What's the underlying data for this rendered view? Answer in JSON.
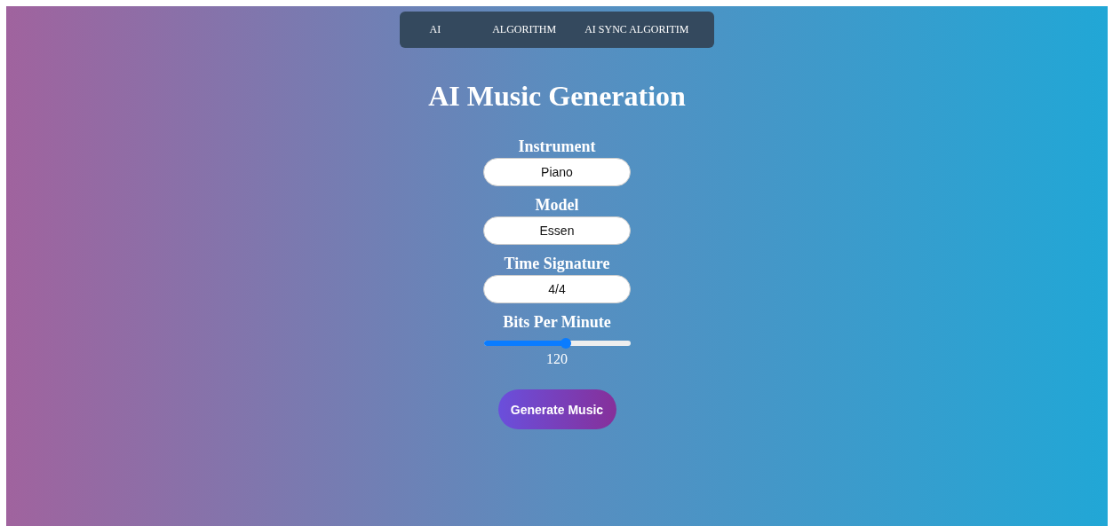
{
  "nav": [
    {
      "label": "AI"
    },
    {
      "label": "ALGORITHM"
    },
    {
      "label": "AI SYNC ALGORITIM"
    }
  ],
  "title": "AI Music Generation",
  "fields": [
    {
      "kind": "text",
      "label": "Instrument",
      "value": "Piano"
    },
    {
      "kind": "text",
      "label": "Model",
      "value": "Essen"
    },
    {
      "kind": "text",
      "label": "Time Signature",
      "value": "4/4"
    },
    {
      "kind": "slider",
      "label": "Bits Per Minute",
      "level": 0.56,
      "reading": "120"
    }
  ],
  "button": "Generate Music"
}
